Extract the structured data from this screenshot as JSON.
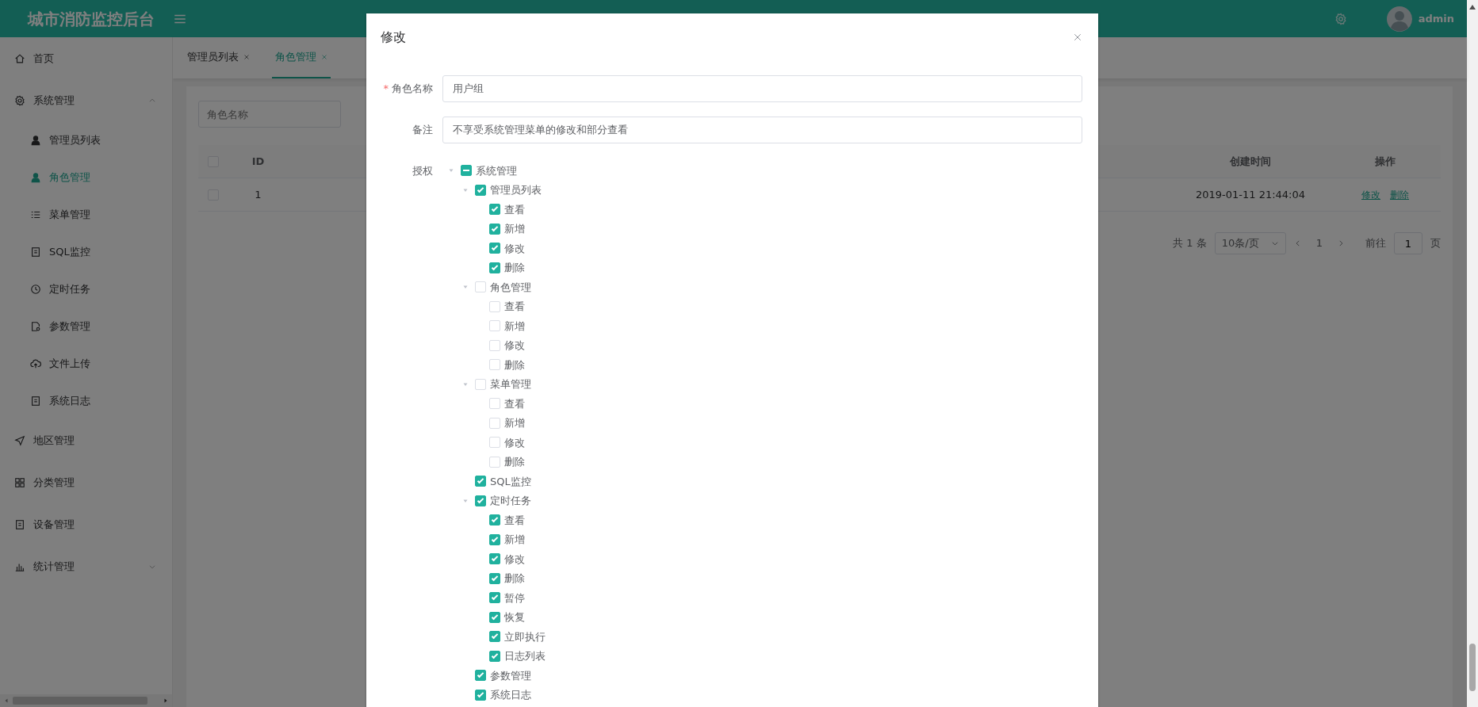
{
  "header": {
    "title": "城市消防监控后台",
    "user": "admin"
  },
  "sidebar": {
    "items": [
      {
        "label": "首页",
        "selected": false
      },
      {
        "label": "系统管理",
        "selected": false,
        "expanded": true,
        "children": [
          {
            "label": "管理员列表",
            "selected": false
          },
          {
            "label": "角色管理",
            "selected": true
          },
          {
            "label": "菜单管理",
            "selected": false
          },
          {
            "label": "SQL监控",
            "selected": false
          },
          {
            "label": "定时任务",
            "selected": false
          },
          {
            "label": "参数管理",
            "selected": false
          },
          {
            "label": "文件上传",
            "selected": false
          },
          {
            "label": "系统日志",
            "selected": false
          }
        ]
      },
      {
        "label": "地区管理",
        "selected": false
      },
      {
        "label": "分类管理",
        "selected": false
      },
      {
        "label": "设备管理",
        "selected": false
      },
      {
        "label": "统计管理",
        "selected": false,
        "expanded": false
      }
    ]
  },
  "tabs": [
    {
      "label": "管理员列表",
      "selected": false
    },
    {
      "label": "角色管理",
      "selected": true
    }
  ],
  "search": {
    "placeholder": "角色名称"
  },
  "table": {
    "all_selected": false,
    "columns": [
      "ID",
      "创建时间",
      "操作"
    ],
    "rows": [
      {
        "selected": false,
        "id": "1",
        "created": "2019-01-11 21:44:04",
        "actions": [
          "修改",
          "删除"
        ]
      }
    ]
  },
  "pagination": {
    "total": "共 1 条",
    "page_size": "10条/页",
    "page": "1",
    "goto_label": "前往",
    "goto_value": "1",
    "page_suffix": "页"
  },
  "dialog": {
    "title": "修改",
    "fields": [
      {
        "label": "角色名称",
        "required_mark": "*",
        "value": "用户组"
      },
      {
        "label": "备注",
        "value": "不享受系统管理菜单的修改和部分查看"
      }
    ],
    "tree_label": "授权",
    "tree": [
      {
        "label": "系统管理",
        "indeterminate": true,
        "expanded": true,
        "children": [
          {
            "label": "管理员列表",
            "checked": true,
            "expanded": true,
            "children": [
              {
                "label": "查看",
                "checked": true
              },
              {
                "label": "新增",
                "checked": true
              },
              {
                "label": "修改",
                "checked": true
              },
              {
                "label": "删除",
                "checked": true
              }
            ]
          },
          {
            "label": "角色管理",
            "checked": false,
            "expanded": true,
            "children": [
              {
                "label": "查看",
                "checked": false
              },
              {
                "label": "新增",
                "checked": false
              },
              {
                "label": "修改",
                "checked": false
              },
              {
                "label": "删除",
                "checked": false
              }
            ]
          },
          {
            "label": "菜单管理",
            "checked": false,
            "expanded": true,
            "children": [
              {
                "label": "查看",
                "checked": false
              },
              {
                "label": "新增",
                "checked": false
              },
              {
                "label": "修改",
                "checked": false
              },
              {
                "label": "删除",
                "checked": false
              }
            ]
          },
          {
            "label": "SQL监控",
            "checked": true
          },
          {
            "label": "定时任务",
            "checked": true,
            "expanded": true,
            "children": [
              {
                "label": "查看",
                "checked": true
              },
              {
                "label": "新增",
                "checked": true
              },
              {
                "label": "修改",
                "checked": true
              },
              {
                "label": "删除",
                "checked": true
              },
              {
                "label": "暂停",
                "checked": true
              },
              {
                "label": "恢复",
                "checked": true
              },
              {
                "label": "立即执行",
                "checked": true
              },
              {
                "label": "日志列表",
                "checked": true
              }
            ]
          },
          {
            "label": "参数管理",
            "checked": true
          },
          {
            "label": "系统日志",
            "checked": true
          }
        ]
      }
    ]
  }
}
